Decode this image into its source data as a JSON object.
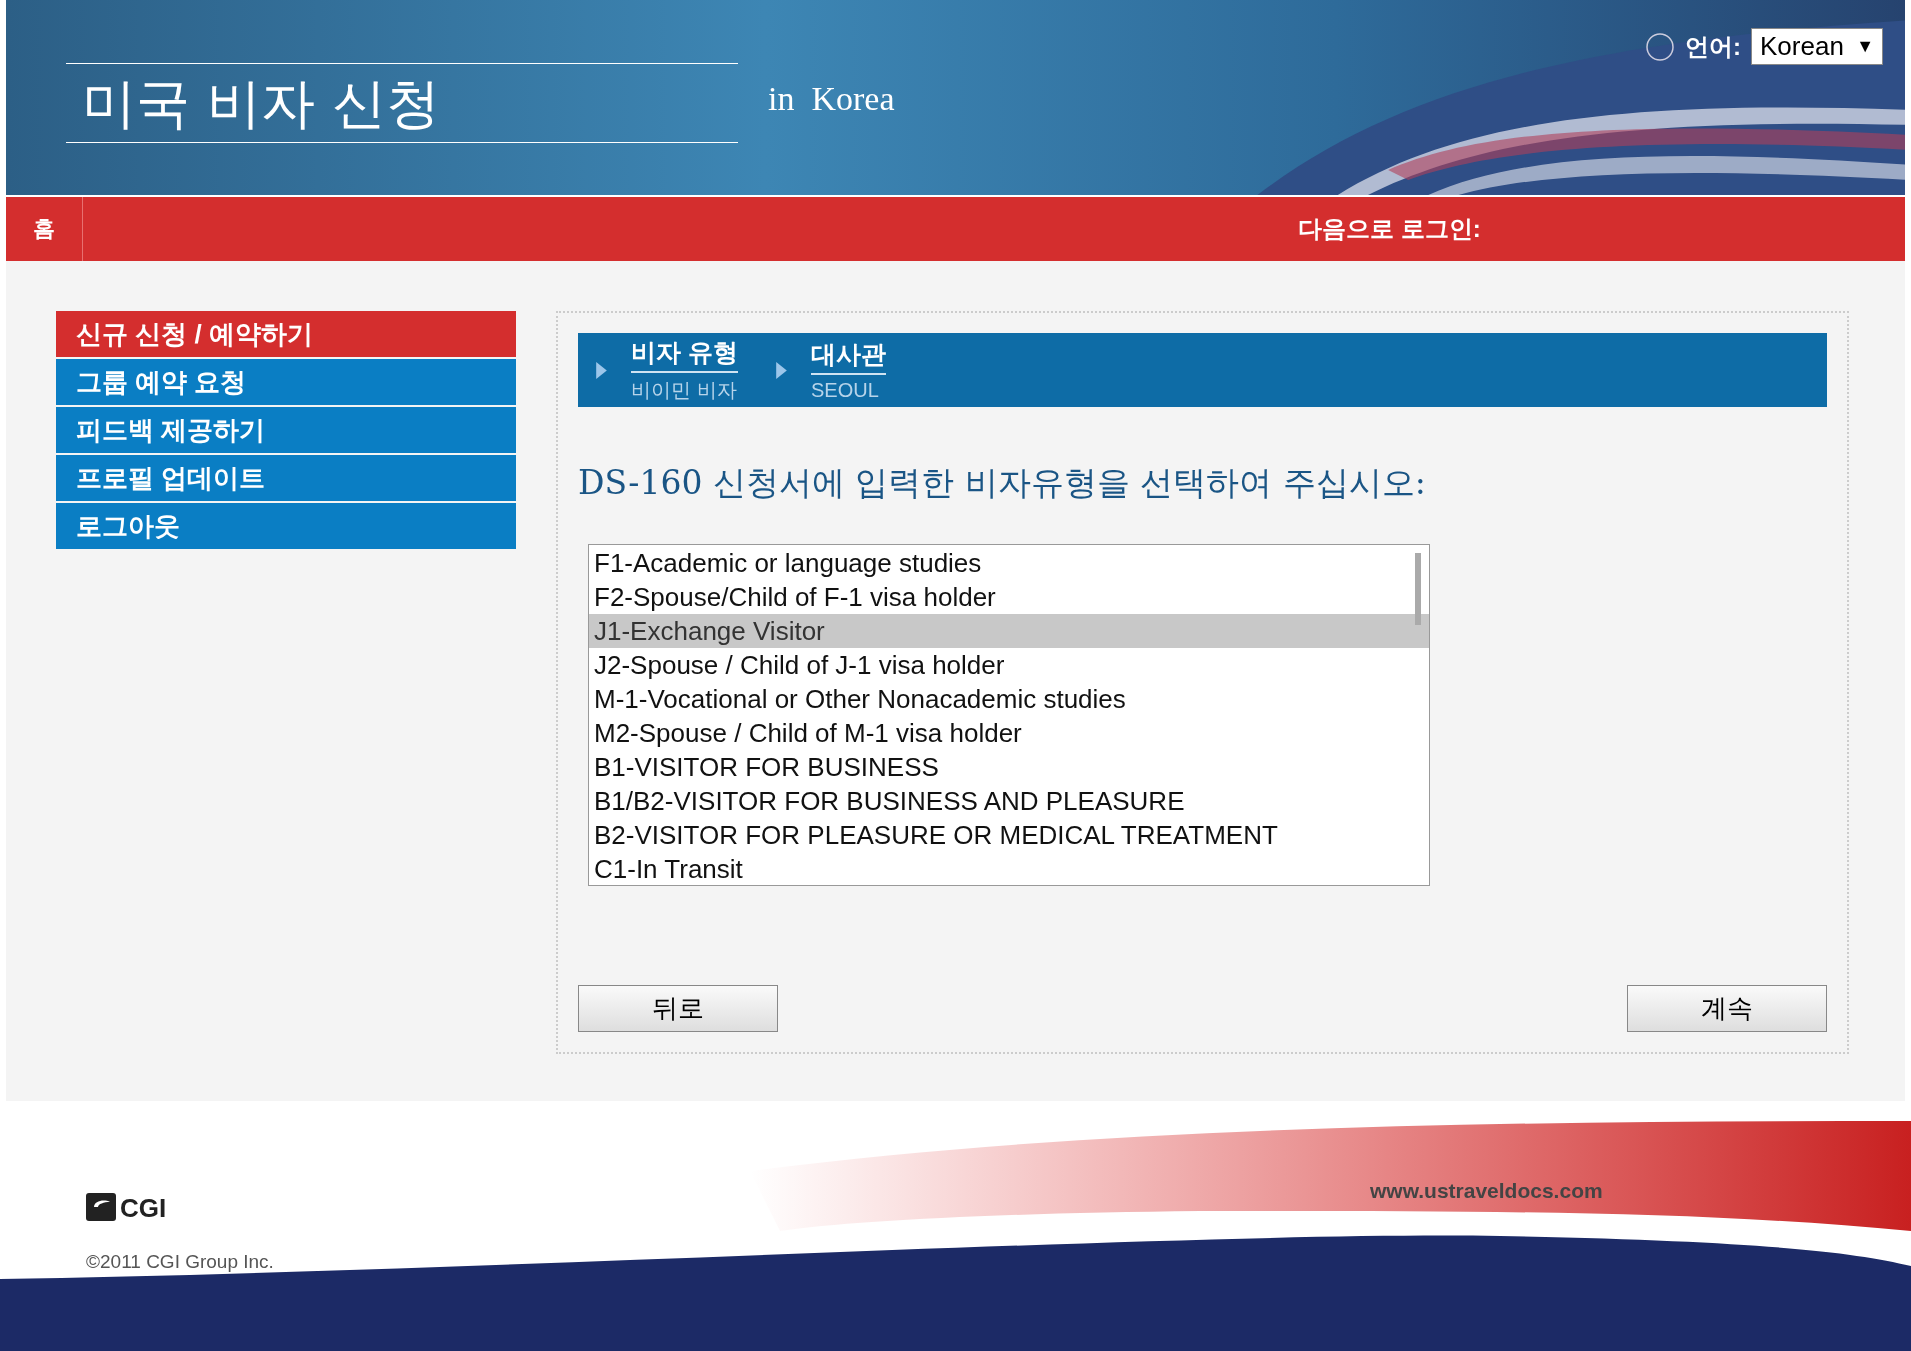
{
  "header": {
    "title": "미국 비자 신청",
    "subtitle": "in  Korea",
    "language_label": "언어:",
    "language_value": "Korean",
    "dropdown_arrow": "▼"
  },
  "nav": {
    "home": "홈",
    "login_label": "다음으로 로그인:"
  },
  "sidebar": {
    "items": [
      {
        "label": "신규 신청 / 예약하기",
        "selected": true
      },
      {
        "label": "그룹 예약 요청",
        "selected": false
      },
      {
        "label": "피드백 제공하기",
        "selected": false
      },
      {
        "label": "프로필 업데이트",
        "selected": false
      },
      {
        "label": "로그아웃",
        "selected": false
      }
    ]
  },
  "breadcrumb": [
    {
      "title": "비자 유형",
      "value": "비이민 비자"
    },
    {
      "title": "대사관",
      "value": "SEOUL"
    }
  ],
  "heading": "DS-160 신청서에 입력한 비자유형을 선택하여 주십시오:",
  "visa_types": [
    {
      "label": "F1-Academic or language studies",
      "selected": false
    },
    {
      "label": "F2-Spouse/Child of F-1 visa holder",
      "selected": false
    },
    {
      "label": "J1-Exchange Visitor",
      "selected": true
    },
    {
      "label": "J2-Spouse / Child of J-1 visa holder",
      "selected": false
    },
    {
      "label": "M-1-Vocational or Other Nonacademic studies",
      "selected": false
    },
    {
      "label": "M2-Spouse / Child of M-1 visa holder",
      "selected": false
    },
    {
      "label": "B1-VISITOR FOR BUSINESS",
      "selected": false
    },
    {
      "label": "B1/B2-VISITOR FOR BUSINESS AND PLEASURE",
      "selected": false
    },
    {
      "label": "B2-VISITOR FOR PLEASURE OR MEDICAL TREATMENT",
      "selected": false
    },
    {
      "label": "C1-In Transit",
      "selected": false
    }
  ],
  "buttons": {
    "back": "뒤로",
    "continue": "계속"
  },
  "footer": {
    "logo": "CGI",
    "copyright": "©2011 CGI Group Inc.",
    "url": "www.ustraveldocs.com"
  }
}
